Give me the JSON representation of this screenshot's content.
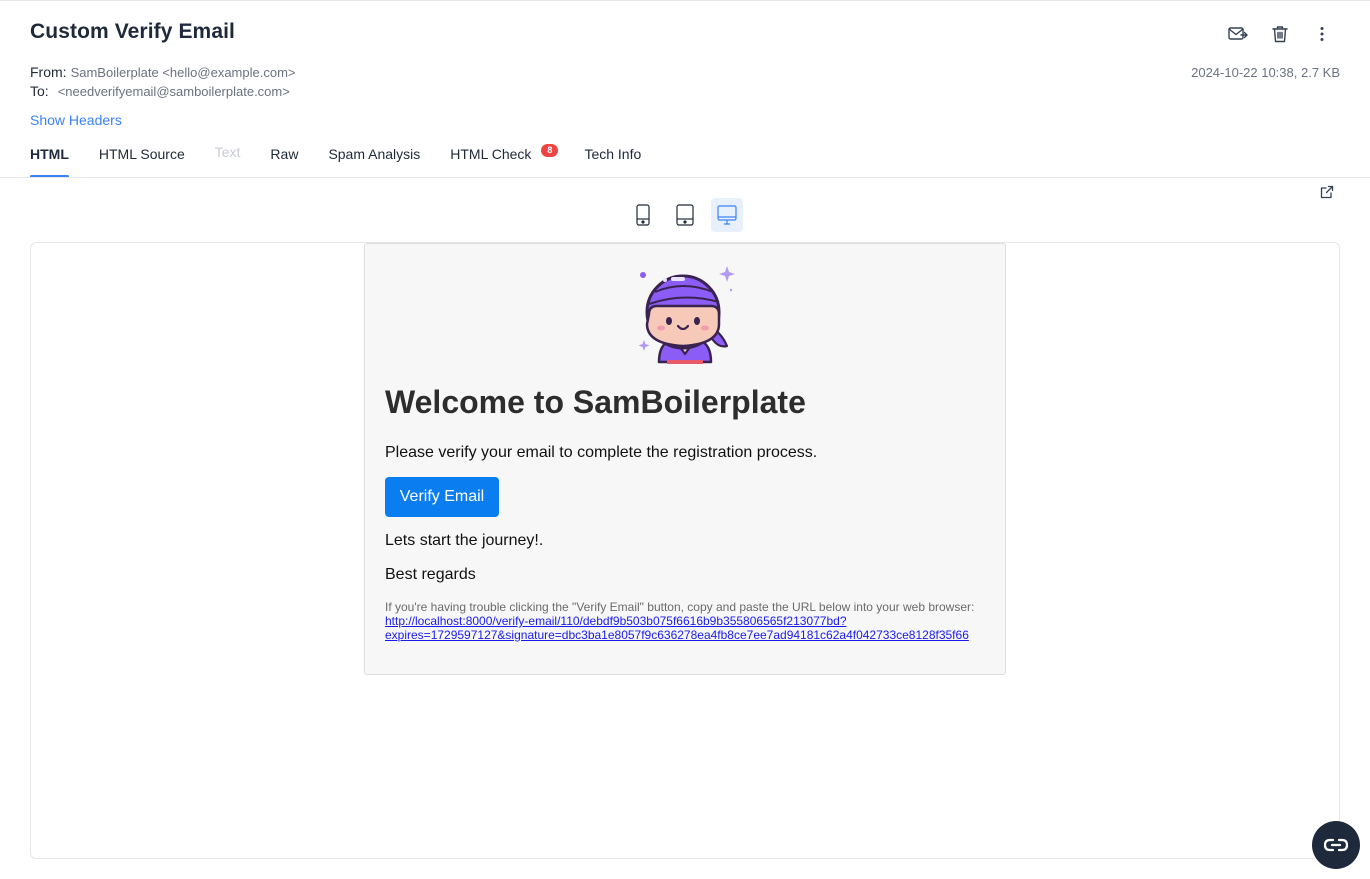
{
  "email": {
    "subject": "Custom Verify Email",
    "from_label": "From:",
    "from_value": "SamBoilerplate <hello@example.com>",
    "to_label": "To:",
    "to_value": "<needverifyemail@samboilerplate.com>",
    "date_size": "2024-10-22 10:38, 2.7 KB",
    "show_headers": "Show Headers"
  },
  "header_actions": {
    "icons": [
      "forward-mail-icon",
      "trash-icon",
      "more-vertical-icon"
    ]
  },
  "tabs": [
    {
      "label": "HTML",
      "state": "active"
    },
    {
      "label": "HTML Source",
      "state": "normal"
    },
    {
      "label": "Text",
      "state": "disabled"
    },
    {
      "label": "Raw",
      "state": "normal"
    },
    {
      "label": "Spam Analysis",
      "state": "normal"
    },
    {
      "label": "HTML Check",
      "state": "normal",
      "badge": "8"
    },
    {
      "label": "Tech Info",
      "state": "normal"
    }
  ],
  "preview": {
    "devices": [
      {
        "name": "mobile-icon",
        "active": false
      },
      {
        "name": "tablet-icon",
        "active": false
      },
      {
        "name": "desktop-icon",
        "active": true
      }
    ]
  },
  "message": {
    "heading": "Welcome to SamBoilerplate",
    "intro": "Please verify your email to complete the registration process.",
    "button_label": "Verify Email",
    "journey": "Lets start the journey!.",
    "regards": "Best regards",
    "trouble_text": "If you're having trouble clicking the \"Verify Email\" button, copy and paste the URL below into your web browser:",
    "link_line1": "http://localhost:8000/verify-email/110/debdf9b503b075f6616b9b355806565f213077bd?",
    "link_line2": "expires=1729597127&signature=dbc3ba1e8057f9c636278ea4fb8ce7ee7ad94181c62a4f042733ce8128f35f66"
  },
  "colors": {
    "accent": "#3b82f6",
    "badge": "#ef4444",
    "verify_button": "#0a7df0",
    "mascot_purple": "#8b5cf6"
  }
}
